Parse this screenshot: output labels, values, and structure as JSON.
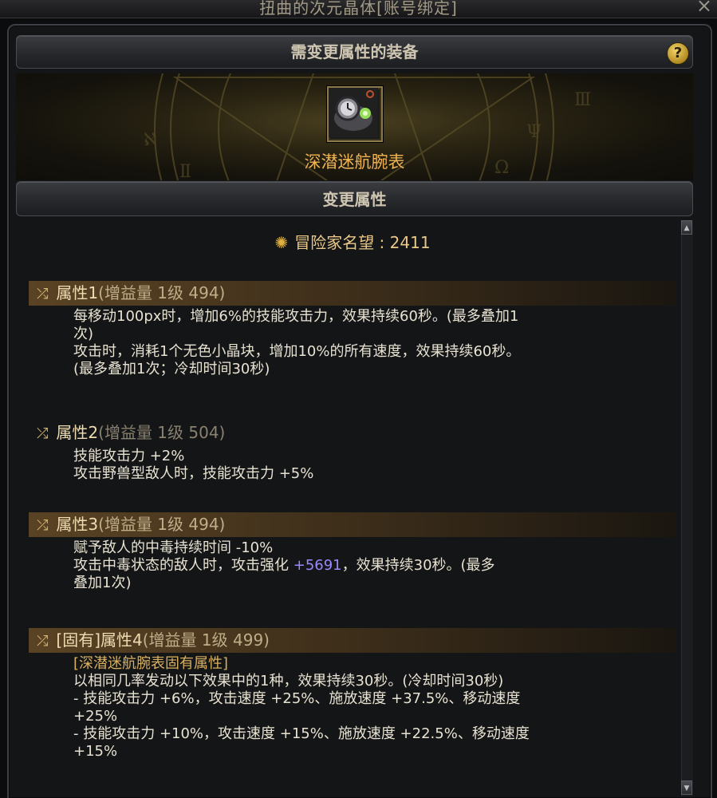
{
  "window": {
    "title": "扭曲的次元晶体[账号绑定]",
    "close": "×"
  },
  "panel": {
    "equip_header": "需变更属性的装备",
    "change_header": "变更属性",
    "help_label": "?"
  },
  "item": {
    "name": "深潜迷航腕表",
    "icon": "watch-icon"
  },
  "fame": {
    "label": "冒险家名望",
    "value": "2411",
    "icon": "fame-star-icon"
  },
  "attributes": [
    {
      "title": "属性1",
      "gain": "(增益量 1级 494)",
      "lines": [
        "每移动100px时，增加6%的技能攻击力，效果持续60秒。(最多叠加1",
        "次)",
        "攻击时，消耗1个无色小晶块，增加10%的所有速度，效果持续60秒。",
        "(最多叠加1次；冷却时间30秒)"
      ]
    },
    {
      "title": "属性2",
      "gain": "(增益量 1级 504)",
      "lines": [
        "技能攻击力 +2%",
        "攻击野兽型敌人时，技能攻击力 +5%"
      ]
    },
    {
      "title": "属性3",
      "gain": "(增益量 1级 494)",
      "lines": [
        "赋予敌人的中毒持续时间 -10%",
        "攻击中毒状态的敌人时，攻击强化 ",
        "叠加1次)"
      ],
      "highlight_value": "+5691",
      "line2_tail": "，效果持续30秒。(最多"
    },
    {
      "title": "[固有]属性4",
      "gain": "(增益量 1级 499)",
      "tag": "[深潜迷航腕表固有属性]",
      "lines": [
        "以相同几率发动以下效果中的1种，效果持续30秒。(冷却时间30秒)",
        "- 技能攻击力 +6%，攻击速度 +25%、施放速度 +37.5%、移动速度",
        "+25%",
        "- 技能攻击力 +10%，攻击速度 +15%、施放速度 +22.5%、移动速度",
        "+15%"
      ]
    }
  ],
  "colors": {
    "item_name": "#f0b454",
    "header_bar": "#5a4324",
    "highlight": "#9a88ff"
  }
}
